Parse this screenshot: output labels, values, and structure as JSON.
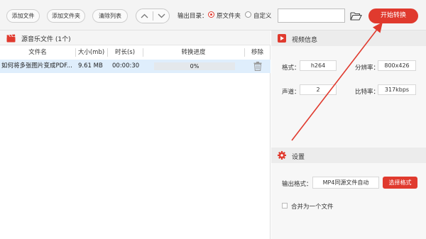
{
  "toolbar": {
    "add_file": "添加文件",
    "add_folder": "添加文件夹",
    "clear_list": "清除列表",
    "output_dir_label": "输出目录：",
    "radio_source": "原文件夹",
    "radio_custom": "自定义",
    "path_value": "",
    "start_button": "开始转换"
  },
  "file_list": {
    "title": "源音乐文件 (1个)",
    "columns": [
      "文件名",
      "大小(mb)",
      "时长(s)",
      "转换进度",
      "移除"
    ],
    "rows": [
      {
        "name": "如何将多张图片变成PDF...",
        "size": "9.61 MB",
        "duration": "00:00:30",
        "progress": "0%"
      }
    ]
  },
  "video_info": {
    "title": "视频信息",
    "format_label": "格式：",
    "format_value": "h264",
    "resolution_label": "分辨率：",
    "resolution_value": "800x426",
    "channel_label": "声道：",
    "channel_value": "2",
    "bitrate_label": "比特率：",
    "bitrate_value": "317kbps"
  },
  "settings": {
    "title": "设置",
    "output_format_label": "输出格式：",
    "output_format_value": "MP4同源文件自动",
    "select_format_button": "选择格式",
    "merge_label": "合并为一个文件"
  },
  "colors": {
    "accent": "#e03a2e",
    "row_highlight": "#dfeefc"
  }
}
